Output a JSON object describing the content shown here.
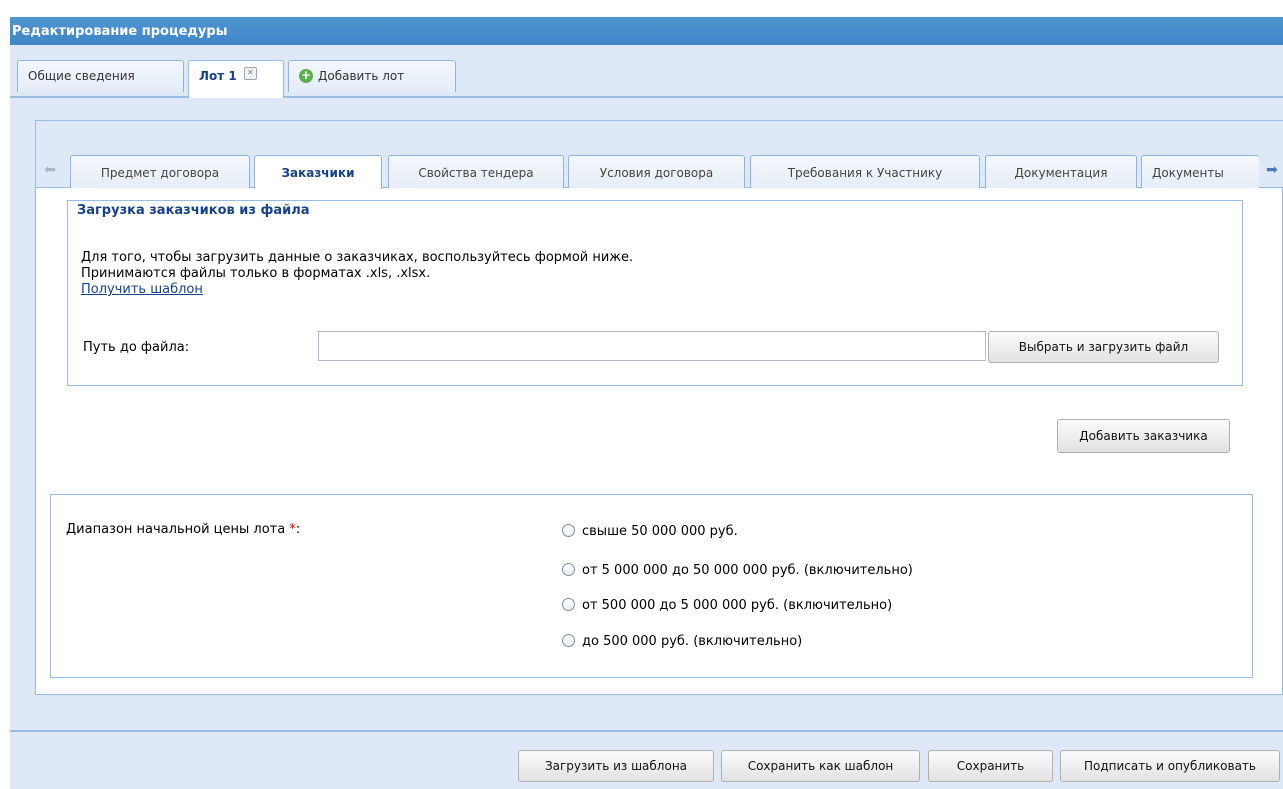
{
  "window": {
    "title": "Редактирование процедуры"
  },
  "top_tabs": {
    "general_label": "Общие сведения",
    "lot_label": "Лот 1",
    "add_lot_label": "Добавить лот"
  },
  "inner_tabs": [
    "Предмет договора",
    "Заказчики",
    "Свойства тендера",
    "Условия договора",
    "Требования к Участнику",
    "Документация",
    "Документы"
  ],
  "active_inner_tab": "Заказчики",
  "upload_section": {
    "legend": "Загрузка заказчиков из файла",
    "line1": "Для того, чтобы загрузить данные о заказчиках, воспользуйтесь формой ниже.",
    "line2": "Принимаются файлы только в форматах .xls, .xlsx.",
    "template_link": "Получить шаблон",
    "file_label": "Путь до файла:",
    "file_value": "",
    "upload_button": "Выбрать и загрузить файл"
  },
  "add_customer_button": "Добавить заказчика",
  "price_range": {
    "label": "Диапазон начальной цены лота",
    "required_mark": "*",
    "options": [
      "свыше 50 000 000 руб.",
      "от 5 000 000 до 50 000 000 руб. (включительно)",
      "от 500 000 до 5 000 000 руб. (включительно)",
      "до 500 000 руб. (включительно)"
    ]
  },
  "footer": {
    "load_template": "Загрузить из шаблона",
    "save_as_template": "Сохранить как шаблон",
    "save": "Сохранить",
    "sign_publish": "Подписать и опубликовать"
  },
  "colors": {
    "header": "#3f86c8",
    "panel_bg": "#dfe8f6",
    "border": "#99bbe8",
    "accent_text": "#15428b",
    "required": "#e00000"
  }
}
